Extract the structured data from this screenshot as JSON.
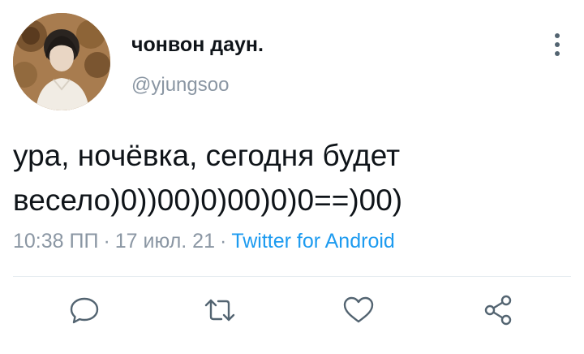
{
  "user": {
    "display_name": "чонвон даун.",
    "handle": "@yjungsoo",
    "avatar_icon": "profile-photo"
  },
  "tweet": {
    "text": "ура, ночёвка, сегодня будет весело)0))00)0)00)0)0==)00)",
    "time": "10:38 ПП",
    "date": "17 июл. 21",
    "separator": "·",
    "source": "Twitter for Android"
  },
  "icons": {
    "more": "more-vertical-icon",
    "reply": "reply-icon",
    "retweet": "retweet-icon",
    "like": "heart-icon",
    "share": "share-icon"
  },
  "colors": {
    "text": "#0f1419",
    "secondary": "#8a96a3",
    "link": "#1d9bf0",
    "icon": "#536471",
    "divider": "#e6ecf0"
  }
}
